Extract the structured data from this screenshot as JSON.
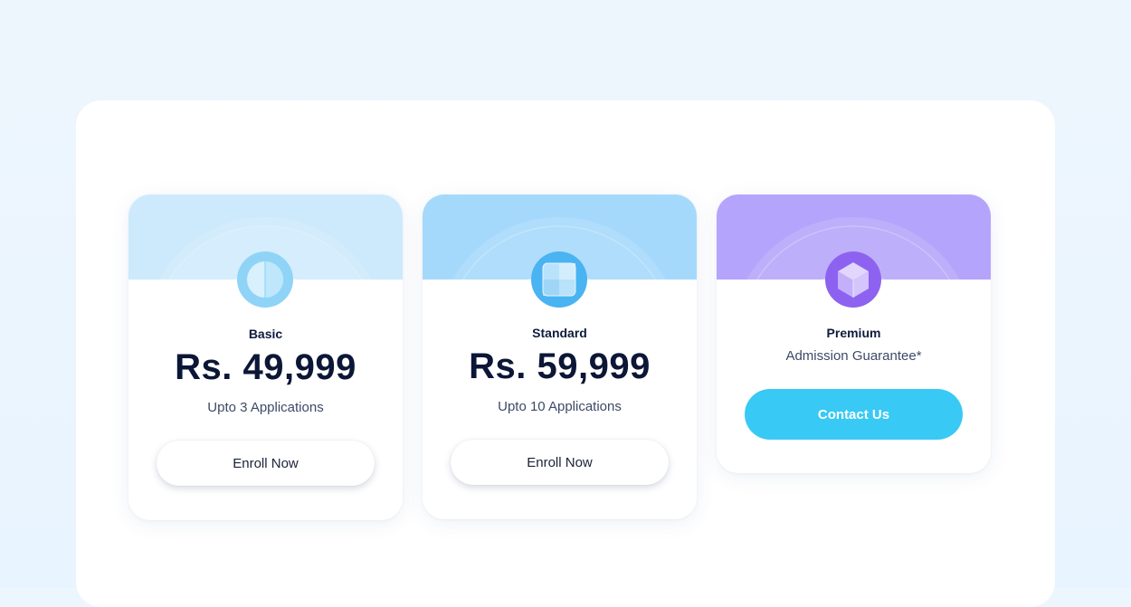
{
  "plans": [
    {
      "name": "Basic",
      "price": "Rs. 49,999",
      "subtitle": "Upto 3 Applications",
      "button": "Enroll Now",
      "icon": "circle-half-icon",
      "banner_color": "#cdeafc",
      "icon_color": "#8fd4f7"
    },
    {
      "name": "Standard",
      "price": "Rs. 59,999",
      "subtitle": "Upto 10 Applications",
      "button": "Enroll Now",
      "icon": "grid-square-icon",
      "banner_color": "#a5d9fb",
      "icon_color": "#4ab3f2"
    },
    {
      "name": "Premium",
      "subtitle": "Admission Guarantee*",
      "button": "Contact Us",
      "icon": "cube-icon",
      "banner_color": "#b5a4fb",
      "icon_color": "#8e62f0"
    }
  ],
  "colors": {
    "page_background": "#ecf6ff",
    "panel_background": "#ffffff",
    "primary_button": "#38c9f5",
    "text_dark": "#0c1636"
  }
}
